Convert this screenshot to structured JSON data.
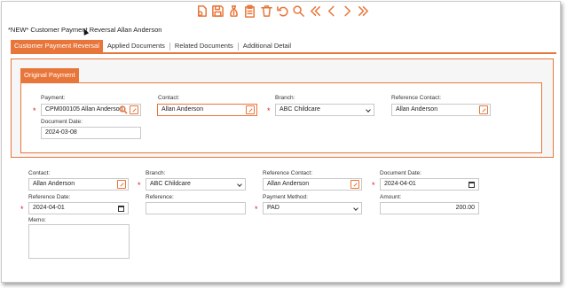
{
  "toolbar": {
    "buttons": [
      {
        "name": "new-doc-icon"
      },
      {
        "name": "save-icon"
      },
      {
        "name": "money-icon"
      },
      {
        "name": "clipboard-icon"
      },
      {
        "name": "delete-icon"
      },
      {
        "name": "undo-icon"
      },
      {
        "name": "search-icon"
      },
      {
        "name": "first-record-icon"
      },
      {
        "name": "previous-record-icon"
      },
      {
        "name": "next-record-icon"
      },
      {
        "name": "last-record-icon"
      }
    ],
    "accent_color": "#e8763a"
  },
  "page": {
    "title": "*NEW* Customer Payment Reversal Allan Anderson"
  },
  "tabs": [
    {
      "label": "Customer Payment Reversal",
      "active": true
    },
    {
      "label": "Applied Documents",
      "active": false
    },
    {
      "label": "Related Documents",
      "active": false
    },
    {
      "label": "Additional Detail",
      "active": false
    }
  ],
  "original_payment": {
    "section_label": "Original Payment",
    "payment_label": "Payment:",
    "payment_value": "CPM000105 Allan Anderson",
    "contact_label": "Contact:",
    "contact_value": "Allan Anderson",
    "branch_label": "Branch:",
    "branch_value": "ABC Childcare",
    "reference_contact_label": "Reference Contact:",
    "reference_contact_value": "Allan Anderson",
    "document_date_label": "Document Date:",
    "document_date_value": "2024-03-08"
  },
  "reversal": {
    "contact_label": "Contact:",
    "contact_value": "Allan Anderson",
    "branch_label": "Branch:",
    "branch_value": "ABC Childcare",
    "reference_contact_label": "Reference Contact:",
    "reference_contact_value": "Allan Anderson",
    "document_date_label": "Document Date:",
    "document_date_value": "2024-04-01",
    "reference_date_label": "Reference Date:",
    "reference_date_value": "2024-04-01",
    "reference_label": "Reference:",
    "reference_value": "",
    "payment_method_label": "Payment Method:",
    "payment_method_value": "PAD",
    "amount_label": "Amount:",
    "amount_value": "200.00",
    "memo_label": "Memo:",
    "memo_value": ""
  },
  "required_marker": "*"
}
